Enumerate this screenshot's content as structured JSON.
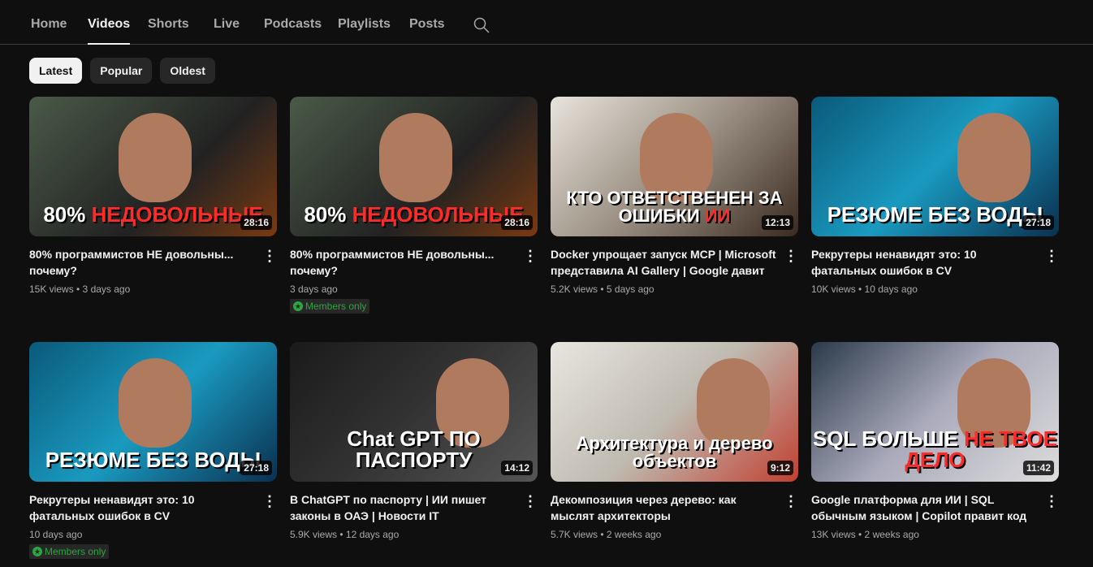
{
  "tabs": [
    "Home",
    "Videos",
    "Shorts",
    "Live",
    "Podcasts",
    "Playlists",
    "Posts"
  ],
  "chips": [
    "Latest",
    "Popular",
    "Oldest"
  ],
  "badge_label": "Members only",
  "videos": [
    {
      "title": "80% программистов НЕ довольны... почему?",
      "meta": "15K views • 3 days ago",
      "duration": "28:16",
      "cap1": "80% ",
      "cap2": "НЕДОВОЛЬНЫЕ",
      "members": false
    },
    {
      "title": "80% программистов НЕ довольны... почему?",
      "meta": "3 days ago",
      "duration": "28:16",
      "cap1": "80% ",
      "cap2": "НЕДОВОЛЬНЫЕ",
      "members": true
    },
    {
      "title": "Docker упрощает запуск MCP | Microsoft представила AI Gallery | Google давит на...",
      "meta": "5.2K views • 5 days ago",
      "duration": "12:13",
      "cap1": "КТО ОТВЕТСТВЕНЕН ЗА ОШИБКИ ",
      "cap2": "ИИ",
      "members": false
    },
    {
      "title": "Рекрутеры ненавидят это: 10 фатальных ошибок в CV",
      "meta": "10K views • 10 days ago",
      "duration": "27:18",
      "cap1": "РЕЗЮМЕ БЕЗ ВОДЫ",
      "cap2": "",
      "members": false
    },
    {
      "title": "Рекрутеры ненавидят это: 10 фатальных ошибок в CV",
      "meta": "10 days ago",
      "duration": "27:18",
      "cap1": "РЕЗЮМЕ БЕЗ ВОДЫ",
      "cap2": "",
      "members": true
    },
    {
      "title": "В ChatGPT по паспорту | ИИ пишет законы в ОАЭ | Новости IT",
      "meta": "5.9K views • 12 days ago",
      "duration": "14:12",
      "cap1": "Chat GPT ПО ПАСПОРТУ",
      "cap2": "",
      "members": false
    },
    {
      "title": "Декомпозиция через дерево: как мыслят архитекторы",
      "meta": "5.7K views • 2 weeks ago",
      "duration": "9:12",
      "cap1": "Архитектура и дерево объектов",
      "cap2": "",
      "members": false
    },
    {
      "title": "Google платформа для ИИ | SQL обычным языком | Copilot правит код",
      "meta": "13K views • 2 weeks ago",
      "duration": "11:42",
      "cap1": "SQL БОЛЬШЕ ",
      "cap2": "НЕ ТВОЕ ДЕЛО",
      "members": false
    }
  ]
}
